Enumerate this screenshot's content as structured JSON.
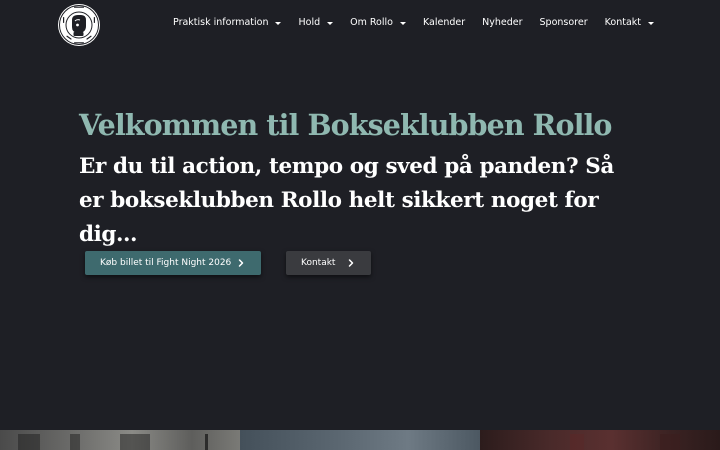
{
  "header": {
    "logo_name": "Bokseklubben Rollo logo",
    "logo_text": "ROLLO · BOKSEKLUBBEN",
    "nav": [
      {
        "label": "Praktisk information",
        "has_dropdown": true
      },
      {
        "label": "Hold",
        "has_dropdown": true
      },
      {
        "label": "Om Rollo",
        "has_dropdown": true
      },
      {
        "label": "Kalender",
        "has_dropdown": false
      },
      {
        "label": "Nyheder",
        "has_dropdown": false
      },
      {
        "label": "Sponsorer",
        "has_dropdown": false
      },
      {
        "label": "Kontakt",
        "has_dropdown": true
      }
    ]
  },
  "hero": {
    "title": "Velkommen til Bokseklubben Rollo",
    "subtitle": "Er du til action, tempo og sved på panden? Så er bokseklubben Rollo helt sikkert noget for dig…",
    "primary_button": "Køb billet til Fight Night 2026",
    "secondary_button": "Kontakt"
  },
  "colors": {
    "background": "#1e1f25",
    "title_accent": "#8fb8b0",
    "primary_button": "#3e6a6e",
    "secondary_button": "#3a3b3f"
  },
  "icons": {
    "dropdown": "chevron-down-icon",
    "button_arrow": "chevron-right-icon"
  }
}
